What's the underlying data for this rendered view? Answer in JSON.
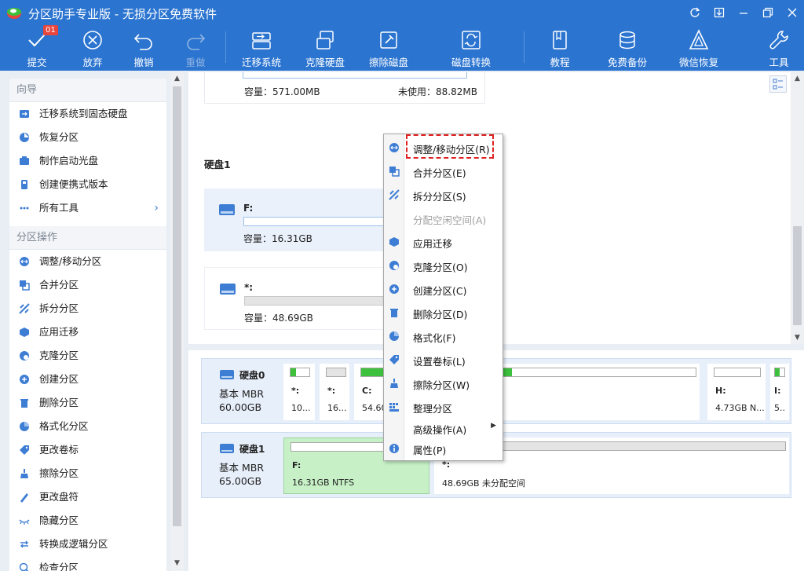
{
  "app": {
    "title": "分区助手专业版 - 无损分区免费软件",
    "window_controls": [
      "refresh-icon",
      "minimize-to-tray-icon",
      "minimize-icon",
      "restore-icon",
      "close-icon"
    ]
  },
  "toolbar": {
    "commit": {
      "label": "提交",
      "badge": "01"
    },
    "discard": "放弃",
    "undo": "撤销",
    "redo": "重做",
    "migrate_os": "迁移系统",
    "clone_disk": "克隆硬盘",
    "wipe_disk": "擦除磁盘",
    "disk_convert": "磁盘转换",
    "tutorial": "教程",
    "free_backup": "免费备份",
    "wechat_recovery": "微信恢复",
    "tools": "工具"
  },
  "sidebar": {
    "wizard_title": "向导",
    "wizard_items": [
      {
        "label": "迁移系统到固态硬盘",
        "icon": "migrate-ssd-icon"
      },
      {
        "label": "恢复分区",
        "icon": "recover-partition-icon"
      },
      {
        "label": "制作启动光盘",
        "icon": "bootable-media-icon"
      },
      {
        "label": "创建便携式版本",
        "icon": "usb-portable-icon"
      },
      {
        "label": "所有工具",
        "icon": "more-tools-icon"
      }
    ],
    "ops_title": "分区操作",
    "ops_items": [
      {
        "label": "调整/移动分区",
        "icon": "resize-move-icon"
      },
      {
        "label": "合并分区",
        "icon": "merge-icon"
      },
      {
        "label": "拆分分区",
        "icon": "split-icon"
      },
      {
        "label": "应用迁移",
        "icon": "app-migrate-icon"
      },
      {
        "label": "克隆分区",
        "icon": "clone-partition-icon"
      },
      {
        "label": "创建分区",
        "icon": "create-partition-icon"
      },
      {
        "label": "删除分区",
        "icon": "delete-partition-icon"
      },
      {
        "label": "格式化分区",
        "icon": "format-icon"
      },
      {
        "label": "更改卷标",
        "icon": "label-icon"
      },
      {
        "label": "擦除分区",
        "icon": "wipe-icon"
      },
      {
        "label": "更改盘符",
        "icon": "drive-letter-icon"
      },
      {
        "label": "隐藏分区",
        "icon": "hide-icon"
      },
      {
        "label": "转换成逻辑分区",
        "icon": "convert-logical-icon"
      },
      {
        "label": "检查分区",
        "icon": "check-icon"
      }
    ]
  },
  "upper": {
    "top_card": {
      "capacity": "容量：571.00MB",
      "unused": "未使用：88.82MB"
    },
    "disk1_title": "硬盘1",
    "partitions": [
      {
        "name": "F:",
        "capacity": "容量：16.31GB"
      },
      {
        "name": "*:",
        "capacity": "容量：48.69GB"
      }
    ]
  },
  "disk_map": {
    "disk0": {
      "name": "硬盘0",
      "type": "基本 MBR",
      "size": "60.00GB",
      "partitions": [
        {
          "label": "*:",
          "size": "10...",
          "used": 0.3
        },
        {
          "label": "*:",
          "size": "16...",
          "used": 0.0
        },
        {
          "label": "C:",
          "size": "54.60",
          "used": 0.45
        },
        {
          "label": "H:",
          "size": "4.73GB N...",
          "used": 0.0
        },
        {
          "label": "I:",
          "size": "5..",
          "used": 0.5
        }
      ]
    },
    "disk1": {
      "name": "硬盘1",
      "type": "基本 MBR",
      "size": "65.00GB",
      "partitions": [
        {
          "label": "F:",
          "size": "16.31GB NTFS"
        },
        {
          "label": "*:",
          "size": "48.69GB 未分配空间"
        }
      ]
    }
  },
  "context_menu": {
    "items": [
      {
        "label": "调整/移动分区(R)",
        "icon": "resize-move-icon",
        "enabled": true
      },
      {
        "label": "合并分区(E)",
        "icon": "merge-icon",
        "enabled": true
      },
      {
        "label": "拆分分区(S)",
        "icon": "split-icon",
        "enabled": true
      },
      {
        "label": "分配空闲空间(A)",
        "icon": "allocate-space-icon",
        "enabled": false
      },
      {
        "label": "应用迁移",
        "icon": "app-migrate-icon",
        "enabled": true
      },
      {
        "label": "克隆分区(O)",
        "icon": "clone-partition-icon",
        "enabled": true
      },
      {
        "label": "创建分区(C)",
        "icon": "create-partition-icon",
        "enabled": true
      },
      {
        "label": "删除分区(D)",
        "icon": "delete-partition-icon",
        "enabled": true
      },
      {
        "label": "格式化(F)",
        "icon": "format-icon",
        "enabled": true
      },
      {
        "label": "设置卷标(L)",
        "icon": "label-icon",
        "enabled": true
      },
      {
        "label": "擦除分区(W)",
        "icon": "wipe-icon",
        "enabled": true
      },
      {
        "label": "整理分区",
        "icon": "defrag-icon",
        "enabled": true
      },
      {
        "label": "高级操作(A)",
        "icon": "",
        "enabled": true,
        "has_submenu": true
      },
      {
        "label": "属性(P)",
        "icon": "info-icon",
        "enabled": true
      }
    ]
  },
  "colors": {
    "toolbar_bg": "#2b74d0",
    "accent": "#3d7bd2",
    "used_green": "#3dc03c",
    "highlight_red": "#e02020",
    "selected_partition": "#c7f0c7"
  }
}
